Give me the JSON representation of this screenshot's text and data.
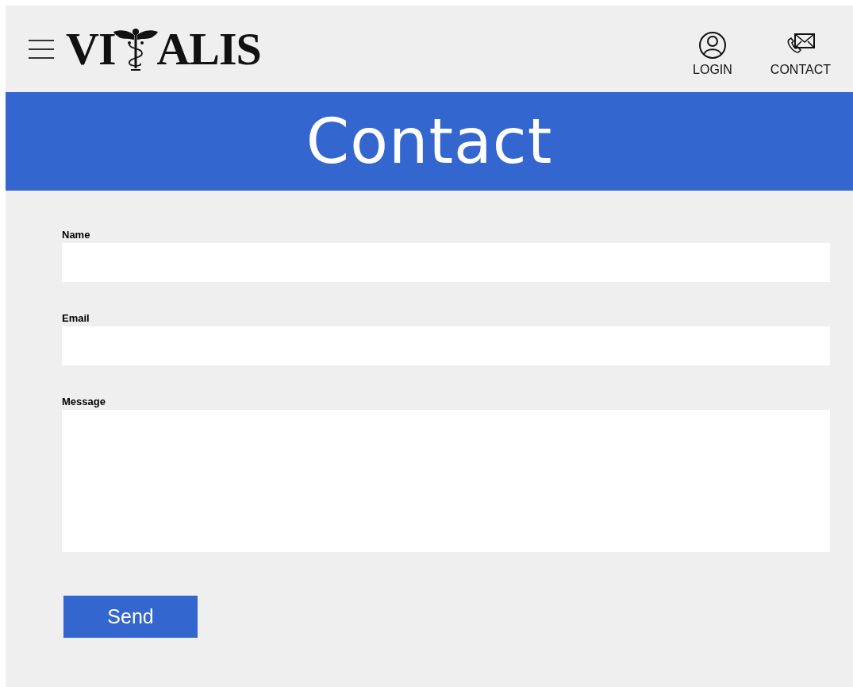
{
  "header": {
    "logo": {
      "before": "VI",
      "after": "ALIS"
    },
    "nav": [
      {
        "kind": "user",
        "label": "LOGIN"
      },
      {
        "kind": "contact",
        "label": "CONTACT"
      }
    ]
  },
  "banner": {
    "title": "Contact"
  },
  "form": {
    "fields": [
      {
        "kind": "input",
        "label": "Name"
      },
      {
        "kind": "input",
        "label": "Email"
      },
      {
        "kind": "textarea",
        "label": "Message"
      }
    ],
    "submit": "Send"
  }
}
